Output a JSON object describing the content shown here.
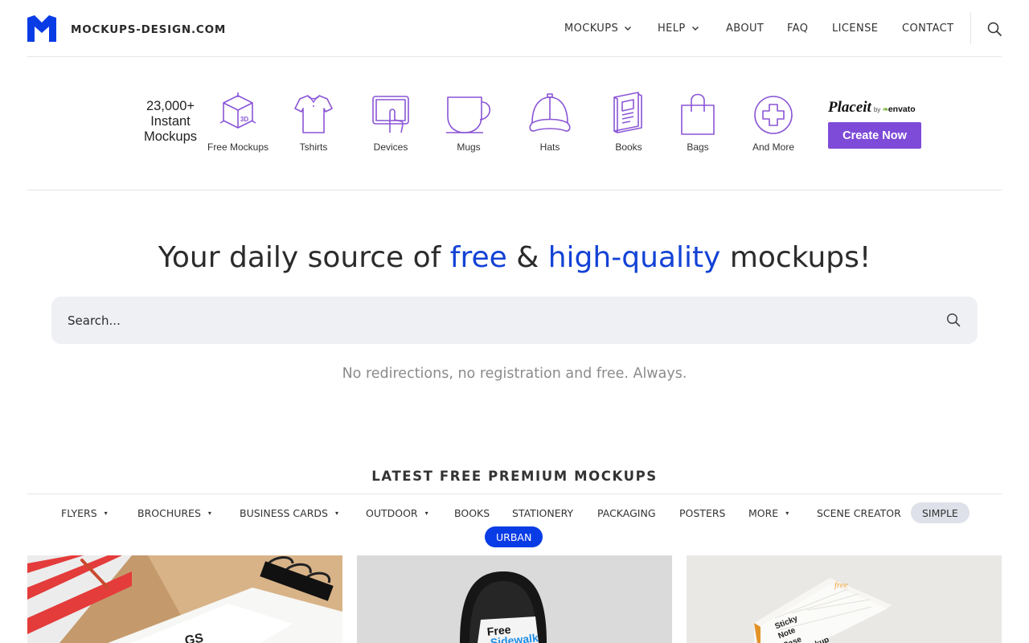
{
  "header": {
    "logo_text": "MOCKUPS-DESIGN.COM",
    "logo_color": "#0a3ce6",
    "nav": [
      {
        "label": "MOCKUPS",
        "dropdown": true
      },
      {
        "label": "HELP",
        "dropdown": true
      },
      {
        "label": "ABOUT",
        "dropdown": false
      },
      {
        "label": "FAQ",
        "dropdown": false
      },
      {
        "label": "LICENSE",
        "dropdown": false
      },
      {
        "label": "CONTACT",
        "dropdown": false
      }
    ],
    "search_icon": "search-icon"
  },
  "banner": {
    "count_line1": "23,000+",
    "count_line2": "Instant",
    "count_line3": "Mockups",
    "categories": [
      {
        "label": "Free Mockups",
        "icon": "3d-box-icon"
      },
      {
        "label": "Tshirts",
        "icon": "tshirt-icon"
      },
      {
        "label": "Devices",
        "icon": "tablet-touch-icon"
      },
      {
        "label": "Mugs",
        "icon": "mug-icon"
      },
      {
        "label": "Hats",
        "icon": "cap-icon"
      },
      {
        "label": "Books",
        "icon": "book-icon"
      },
      {
        "label": "Bags",
        "icon": "bag-icon"
      },
      {
        "label": "And More",
        "icon": "plus-circle-icon"
      }
    ],
    "icon_3d_text": "3D",
    "placeit_brand": "Placeit",
    "placeit_by": "by",
    "placeit_partner": "envato",
    "cta_label": "Create Now",
    "accent_color": "#7e4bd8"
  },
  "hero": {
    "title_part1": "Your daily source of ",
    "title_accent1": "free",
    "title_part2": " & ",
    "title_accent2": "high-quality",
    "title_part3": " mockups!",
    "accent_color": "#1342d6",
    "search_placeholder": "Search...",
    "tagline": "No redirections, no registration and free. Always."
  },
  "latest": {
    "heading": "LATEST FREE PREMIUM MOCKUPS",
    "filters": [
      {
        "label": "FLYERS",
        "dropdown": true
      },
      {
        "label": "BROCHURES",
        "dropdown": true
      },
      {
        "label": "BUSINESS CARDS",
        "dropdown": true
      },
      {
        "label": "OUTDOOR",
        "dropdown": true
      },
      {
        "label": "BOOKS",
        "dropdown": false
      },
      {
        "label": "STATIONERY",
        "dropdown": false
      },
      {
        "label": "PACKAGING",
        "dropdown": false
      },
      {
        "label": "POSTERS",
        "dropdown": false
      },
      {
        "label": "MORE",
        "dropdown": true
      },
      {
        "label": "SCENE CREATOR",
        "dropdown": false
      },
      {
        "label": "SIMPLE",
        "dropdown": false,
        "state": "highlighted"
      },
      {
        "label": "URBAN",
        "dropdown": false,
        "state": "active"
      }
    ],
    "caret": "▾",
    "thumbnails": [
      {
        "subject": "stationery-mockup",
        "visible_text": "GS"
      },
      {
        "subject": "sidewalk-sign-mockup",
        "visible_text_line1": "Free",
        "visible_text_line2": "Sidewalk"
      },
      {
        "subject": "sticky-note-case-mockup",
        "visible_text_1": "Sticky",
        "visible_text_2": "Note",
        "visible_text_3": "Case",
        "visible_text_4": "kup",
        "brand_mark": "free"
      }
    ]
  }
}
